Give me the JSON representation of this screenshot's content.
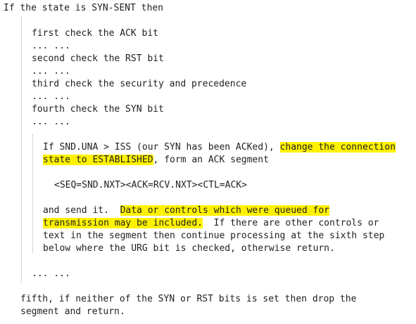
{
  "colors": {
    "highlight": "#fff200",
    "text": "#1f1f1f",
    "rule": "#d4d4d4"
  },
  "doc": {
    "heading": "If the state is SYN-SENT then",
    "steps": {
      "first": "first check the ACK bit",
      "ellipsis1": "... ...",
      "second": "second check the RST bit",
      "ellipsis2": "... ...",
      "third": "third check the security and precedence",
      "ellipsis3": "... ...",
      "fourth": "fourth check the SYN bit",
      "ellipsis4": "... ..."
    },
    "para1": {
      "l1_a": "If SND.UNA > ISS (our SYN has been ACKed), ",
      "l1_hl": "change the connection",
      "l2_hl": "state to ESTABLISHED",
      "l2_b": ", form an ACK segment"
    },
    "segment": "<SEQ=SND.NXT><ACK=RCV.NXT><CTL=ACK>",
    "para2": {
      "l1_a": "and send it.  ",
      "l1_hl": "Data or controls which were queued for",
      "l2_hl": "transmission may be included.",
      "l2_b": "  If there are other controls or",
      "l3": "text in the segment then continue processing at the sixth step",
      "l4": "below where the URG bit is checked, otherwise return."
    },
    "ellipsis5": "... ...",
    "fifth": {
      "l1": "fifth, if neither of the SYN or RST bits is set then drop the",
      "l2": "segment and return."
    }
  }
}
